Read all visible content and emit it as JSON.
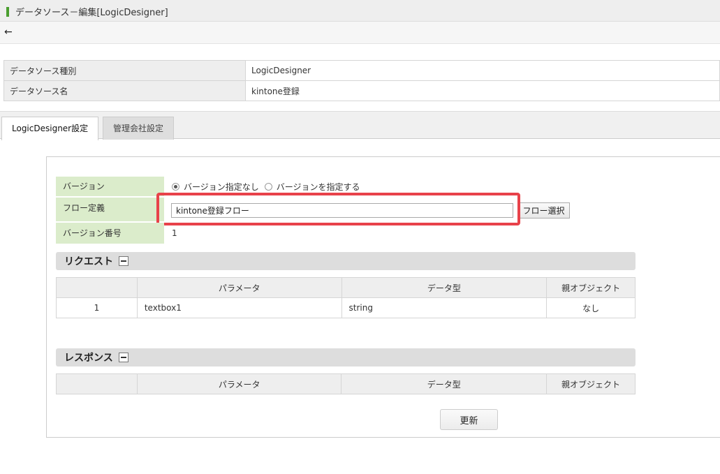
{
  "header": {
    "title": "データソース－編集[LogicDesigner]",
    "back_icon": "←"
  },
  "info": {
    "rows": [
      {
        "label": "データソース種別",
        "value": "LogicDesigner"
      },
      {
        "label": "データソース名",
        "value": "kintone登録"
      }
    ]
  },
  "tabs": [
    {
      "label": "LogicDesigner設定",
      "active": true
    },
    {
      "label": "管理会社設定",
      "active": false
    }
  ],
  "form": {
    "version_label": "バージョン",
    "version_options": [
      {
        "label": "バージョン指定なし",
        "checked": true
      },
      {
        "label": "バージョンを指定する",
        "checked": false
      }
    ],
    "flow_label": "フロー定義",
    "flow_value": "kintone登録フロー",
    "flow_button": "フロー選択",
    "version_number_label": "バージョン番号",
    "version_number": "1"
  },
  "request": {
    "title": "リクエスト",
    "headers": [
      "",
      "パラメータ",
      "データ型",
      "親オブジェクト"
    ],
    "rows": [
      [
        "1",
        "textbox1",
        "string",
        "なし"
      ]
    ]
  },
  "response": {
    "title": "レスポンス",
    "headers": [
      "",
      "パラメータ",
      "データ型",
      "親オブジェクト"
    ]
  },
  "update_button": "更新",
  "colors": {
    "label_green": "#dbeccb",
    "highlight_red": "#e8424a",
    "title_mark": "#4a9e2f"
  }
}
